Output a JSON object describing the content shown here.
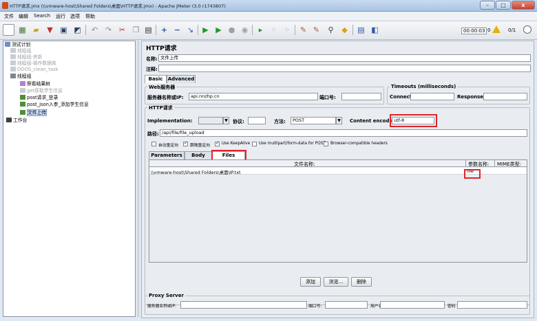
{
  "window": {
    "title": "HTTP请求.jmx (\\\\vmware-host\\Shared Folders\\桌面\\HTTP请求.jmx) - Apache JMeter (3.0 r1743807)",
    "min": "–",
    "max": "□",
    "close": "x"
  },
  "menu": [
    "文件",
    "编辑",
    "Search",
    "运行",
    "选项",
    "帮助"
  ],
  "toolbar": {
    "elapsed": "00:00:03",
    "errors": "0",
    "threads": "0/1"
  },
  "tree": [
    {
      "label": "测试计划"
    },
    {
      "label": "线程组"
    },
    {
      "label": "线程组-夹新"
    },
    {
      "label": "线程组-操作数据库"
    },
    {
      "label": "DDOS_clean_task"
    },
    {
      "label": "线程组"
    },
    {
      "label": "察看结果树"
    },
    {
      "label": "get获取学生信息"
    },
    {
      "label": "post请求_登录"
    },
    {
      "label": "post_json入参_添加学生信息"
    },
    {
      "label": "文件上传"
    },
    {
      "label": "工作台"
    }
  ],
  "panel": {
    "heading": "HTTP请求",
    "name_label": "名称:",
    "name_value": "文件上传",
    "comment_label": "注释:",
    "tabs": [
      "Basic",
      "Advanced"
    ],
    "web_server_title": "Web服务器",
    "server_label": "服务器名称或IP:",
    "server_value": "api.nnzhp.cn",
    "port_label": "端口号:",
    "timeouts_title": "Timeouts (milliseconds)",
    "connect_label": "Connect:",
    "response_label": "Response:",
    "http_title": "HTTP请求",
    "impl_label": "Implementation:",
    "protocol_label": "协议:",
    "method_label": "方法:",
    "method_value": "POST",
    "encoding_label": "Content encoding:",
    "encoding_value": "utf-8",
    "path_label": "路径:",
    "path_value": "/api/file/file_upload",
    "checkboxes": [
      {
        "label": "自动重定向",
        "checked": false
      },
      {
        "label": "跟随重定向",
        "checked": true
      },
      {
        "label": "Use KeepAlive",
        "checked": true
      },
      {
        "label": "Use multipart/form-data for POST",
        "checked": false
      },
      {
        "label": "Browser-compatible headers",
        "checked": false
      }
    ],
    "subtabs": [
      "Parameters",
      "Body Data",
      "Files Upload"
    ],
    "files_table": {
      "columns": [
        "文件名称:",
        "参数名称:",
        "MIME类型:"
      ],
      "rows": [
        {
          "file": "\\\\vmware-host\\Shared Folders\\桌面\\IP.txt",
          "param": "file",
          "mime": ""
        }
      ]
    },
    "buttons": {
      "add": "添加",
      "browse": "浏览...",
      "delete": "删除"
    },
    "proxy_title": "Proxy Server",
    "proxy_host_label": "服务器名称或IP:",
    "proxy_port_label": "端口号:",
    "proxy_user_label": "用户名",
    "proxy_pass_label": "密码"
  },
  "colors": {
    "highlight": "#e0242a",
    "selection": "#c6d8f5"
  }
}
